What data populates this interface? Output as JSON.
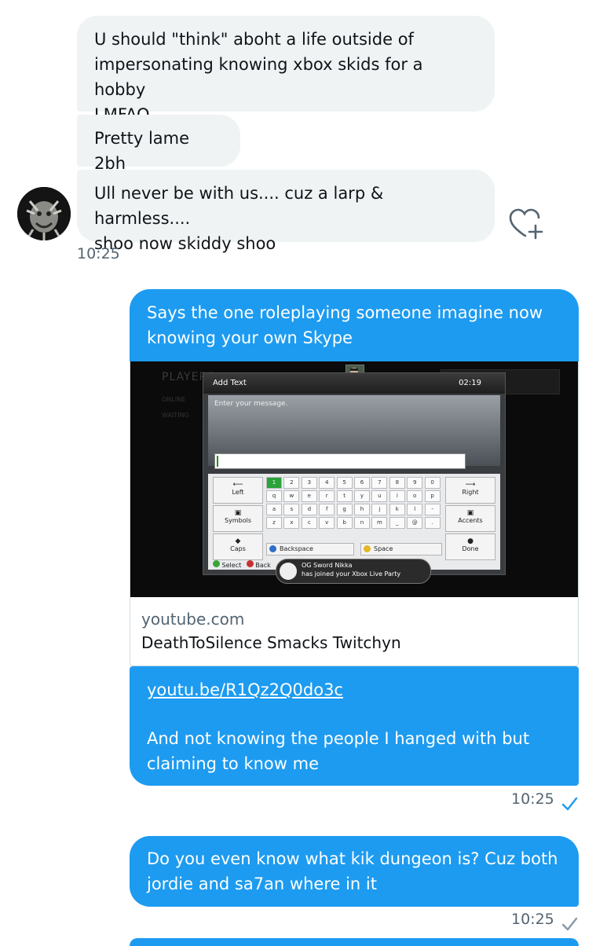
{
  "messages": {
    "in1": {
      "line1": "U should \"think\" aboht a life outside of",
      "line2": "impersonating knowing xbox skids for a hobby",
      "line3": "LMFAO"
    },
    "in2": {
      "line1": "Pretty lame 2bh"
    },
    "in3": {
      "line1": "Ull never be with us.... cuz a larp & harmless....",
      "line2": "shoo now skiddy shoo"
    },
    "in_time": "10:25",
    "out1": {
      "line1": "Says the one roleplaying someone imagine now",
      "line2": "knowing your own Skype"
    },
    "card": {
      "domain": "youtube.com",
      "title": "DeathToSilence Smacks Twitchyn",
      "media": {
        "header_text": "Add Text",
        "clock": "02:19",
        "prompt": "Enter your message.",
        "bg_title": "PLAYERS",
        "bg_sub1": "ONLINE",
        "bg_sub2": "WAITING",
        "keys_row1": [
          "1",
          "2",
          "3",
          "4",
          "5",
          "6",
          "7",
          "8",
          "9",
          "0"
        ],
        "keys_row2": [
          "q",
          "w",
          "e",
          "r",
          "t",
          "y",
          "u",
          "i",
          "o",
          "p"
        ],
        "keys_row3": [
          "a",
          "s",
          "d",
          "f",
          "g",
          "h",
          "j",
          "k",
          "l",
          "-"
        ],
        "keys_row4": [
          "z",
          "x",
          "c",
          "v",
          "b",
          "n",
          "m",
          "_",
          "@",
          "."
        ],
        "left_keys": [
          "Left",
          "Symbols",
          "Caps"
        ],
        "right_keys": [
          "Right",
          "Accents",
          "Done"
        ],
        "backspace": "Backspace",
        "space": "Space",
        "select": "Select",
        "back": "Back",
        "notif_name": "OG Sword Nikka",
        "notif_text": "has joined your Xbox Live Party"
      }
    },
    "out2": {
      "link": "youtu.be/R1Qz2Q0do3c",
      "line1": "And not knowing the people I hanged with but",
      "line2": "claiming to know me"
    },
    "out2_time": "10:25",
    "out3": {
      "line1": "Do you even know what kik dungeon is? Cuz both",
      "line2": "jordie and sa7an where in it"
    },
    "out3_time": "10:25"
  },
  "colors": {
    "outgoing_bubble": "#1d9bf0",
    "incoming_bubble": "#eff3f4",
    "read_check": "#1d9bf0",
    "sent_check": "#8b98a5"
  },
  "icons": {
    "react": "heart-plus-icon",
    "read": "check-icon"
  }
}
